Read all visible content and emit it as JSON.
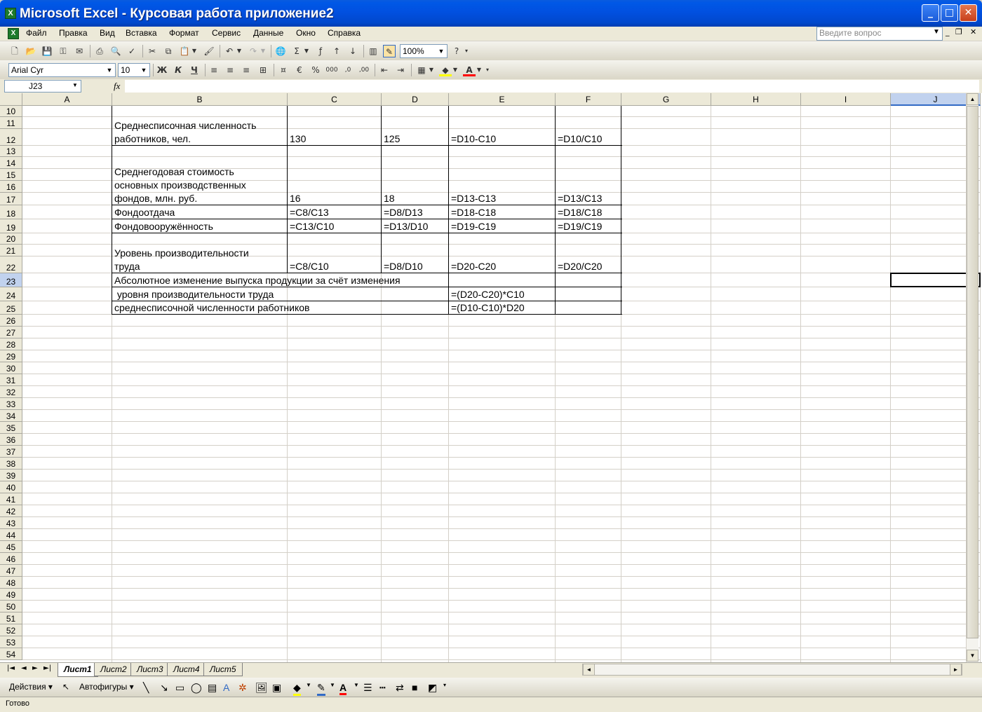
{
  "window": {
    "title": "Microsoft Excel - Курсовая работа приложение2",
    "app_icon": "excel-icon"
  },
  "menu": {
    "items": [
      "Файл",
      "Правка",
      "Вид",
      "Вставка",
      "Формат",
      "Сервис",
      "Данные",
      "Окно",
      "Справка"
    ],
    "help_placeholder": "Введите вопрос"
  },
  "toolbar": {
    "zoom": "100%",
    "font_name": "Arial Cyr",
    "font_size": "10"
  },
  "formula_bar": {
    "name_box": "J23",
    "fx_label": "fx",
    "formula": ""
  },
  "grid": {
    "columns": [
      "A",
      "B",
      "C",
      "D",
      "E",
      "F",
      "G",
      "H",
      "I",
      "J"
    ],
    "selected_column": "J",
    "selected_row": "23",
    "rows": [
      "10",
      "11",
      "12",
      "13",
      "14",
      "15",
      "16",
      "17",
      "18",
      "19",
      "20",
      "21",
      "22",
      "23",
      "24",
      "25",
      "26",
      "27",
      "28",
      "29",
      "30",
      "31",
      "32",
      "33",
      "34",
      "35",
      "36",
      "37",
      "38",
      "39",
      "40",
      "41",
      "42",
      "43",
      "44",
      "45",
      "46",
      "47",
      "48",
      "49",
      "50",
      "51",
      "52",
      "53",
      "54"
    ],
    "cells": {
      "r11_b": "Среднесписочная численность\nработников, чел.",
      "r12_c": "130",
      "r12_d": "125",
      "r12_e": "=D10-C10",
      "r12_f": "=D10/C10",
      "r14_b": "Среднегодовая стоимость\nосновных производственных\nфондов, млн. руб.",
      "r17_c": "16",
      "r17_d": "18",
      "r17_e": "=D13-C13",
      "r17_f": "=D13/C13",
      "r18_b": "Фондоотдача",
      "r18_c": "=C8/C13",
      "r18_d": "=D8/D13",
      "r18_e": "=D18-C18",
      "r18_f": "=D18/C18",
      "r19_b": "Фондовооружённость",
      "r19_c": "=C13/C10",
      "r19_d": "=D13/D10",
      "r19_e": "=D19-C19",
      "r19_f": "=D19/C19",
      "r21_b": "Уровень производительности\nтруда",
      "r22_c": "=C8/C10",
      "r22_d": "=D8/D10",
      "r22_e": "=D20-C20",
      "r22_f": "=D20/C20",
      "r23_b": "Абсолютное изменение выпуска продукции за счёт изменения",
      "r24_b": " уровня производительности труда",
      "r24_e": "=(D20-C20)*C10",
      "r25_b": "среднесписочной численности работников",
      "r25_e": "=(D10-C10)*D20"
    }
  },
  "sheets": {
    "tabs": [
      "Лист1",
      "Лист2",
      "Лист3",
      "Лист4",
      "Лист5"
    ],
    "active": "Лист1"
  },
  "drawing": {
    "actions": "Действия",
    "autoshapes": "Автофигуры"
  },
  "status": {
    "text": "Готово"
  },
  "colors": {
    "title_blue": "#0150E0",
    "selection": "#C1D2EE",
    "header_bg": "#ECE9D8"
  }
}
